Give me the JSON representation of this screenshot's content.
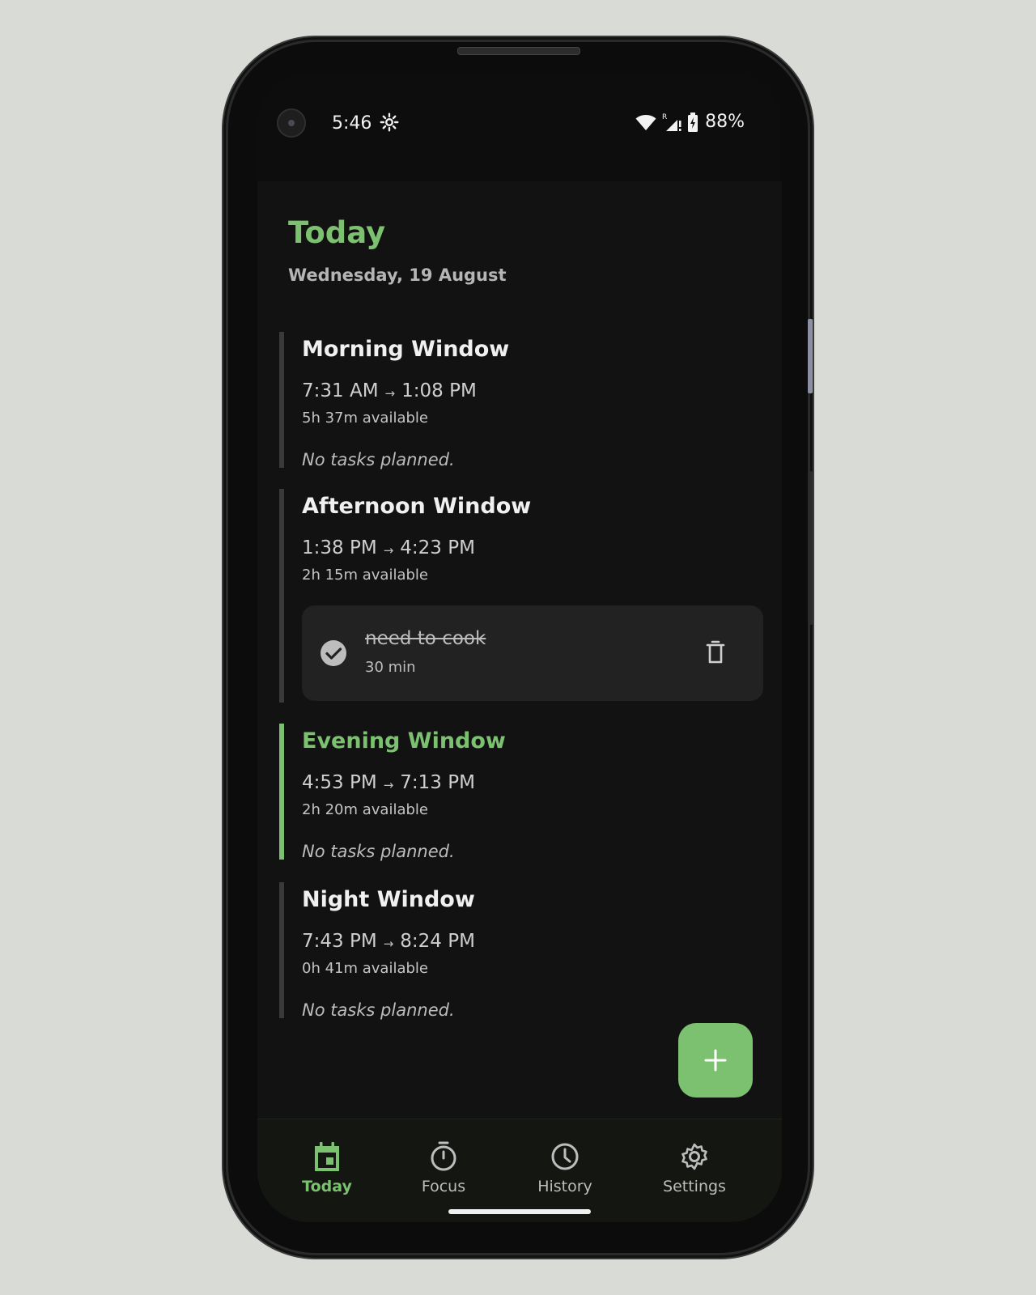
{
  "status_bar": {
    "time": "5:46",
    "battery": "88%",
    "icons": [
      "gear-icon",
      "wifi-icon",
      "signal-icon",
      "battery-icon"
    ]
  },
  "header": {
    "title": "Today",
    "date": "Wednesday, 19 August"
  },
  "windows": [
    {
      "name": "Morning Window",
      "start": "7:31 AM",
      "end": "1:08 PM",
      "arrow": "→",
      "available": "5h 37m available",
      "empty_text": "No tasks planned."
    },
    {
      "name": "Afternoon Window",
      "start": "1:38 PM",
      "end": "4:23 PM",
      "arrow": "→",
      "available": "2h 15m available",
      "tasks": [
        {
          "name": "need to cook",
          "duration": "30 min",
          "completed": true
        }
      ]
    },
    {
      "name": "Evening Window",
      "start": "4:53 PM",
      "end": "7:13 PM",
      "arrow": "→",
      "available": "2h 20m available",
      "empty_text": "No tasks planned.",
      "active": true
    },
    {
      "name": "Night Window",
      "start": "7:43 PM",
      "end": "8:24 PM",
      "arrow": "→",
      "available": "0h 41m available",
      "empty_text": "No tasks planned."
    }
  ],
  "fab": {
    "icon": "plus-icon"
  },
  "nav": {
    "items": [
      {
        "label": "Today",
        "icon": "calendar-icon",
        "active": true
      },
      {
        "label": "Focus",
        "icon": "timer-icon"
      },
      {
        "label": "History",
        "icon": "clock-icon"
      },
      {
        "label": "Settings",
        "icon": "gear-icon"
      }
    ]
  },
  "colors": {
    "accent": "#7cc16f",
    "background": "#121212",
    "card": "#222222",
    "outer": "#d9dbd7"
  }
}
